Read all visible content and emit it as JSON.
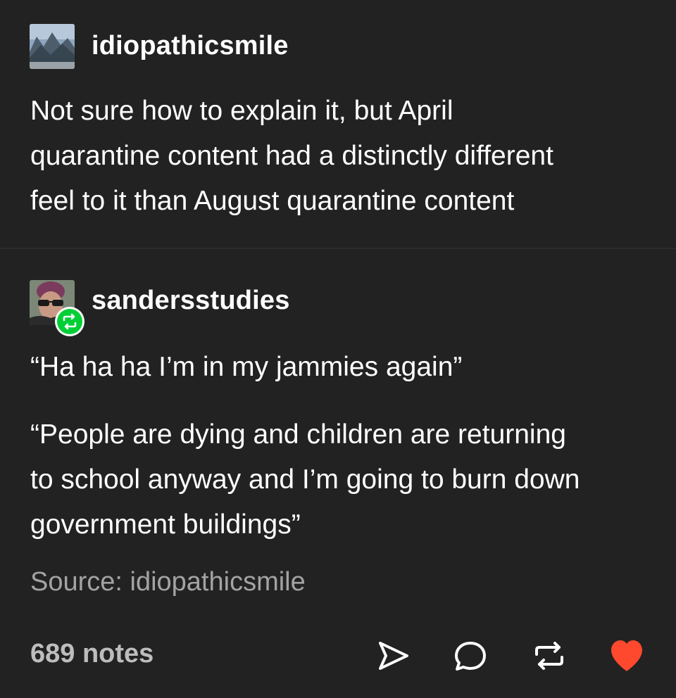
{
  "original_post": {
    "username": "idiopathicsmile",
    "avatar_icon": "mountain-landscape-avatar",
    "lines": [
      "Not sure how to explain it, but April",
      "quarantine content had a distinctly different",
      "feel to it than August quarantine content"
    ]
  },
  "reblog_post": {
    "username": "sandersstudies",
    "avatar_icon": "person-with-sunglasses-avatar",
    "badge_icon": "reblog-icon",
    "badge_color": "#00cf35",
    "quote1": "“Ha ha ha I’m in my jammies again”",
    "quote2_lines": [
      "“People are dying and children are returning",
      "to school anyway and I’m going to burn down",
      "government buildings”"
    ]
  },
  "source": "Source: idiopathicsmile",
  "footer": {
    "notes": "689 notes",
    "actions": [
      {
        "icon": "send-icon"
      },
      {
        "icon": "reply-icon"
      },
      {
        "icon": "reblog-icon"
      },
      {
        "icon": "heart-icon",
        "color": "#ff492f"
      }
    ]
  },
  "colors": {
    "background": "#222222",
    "text": "#ffffff",
    "muted": "#a3a3a3",
    "like": "#ff492f",
    "reblog": "#00cf35"
  }
}
